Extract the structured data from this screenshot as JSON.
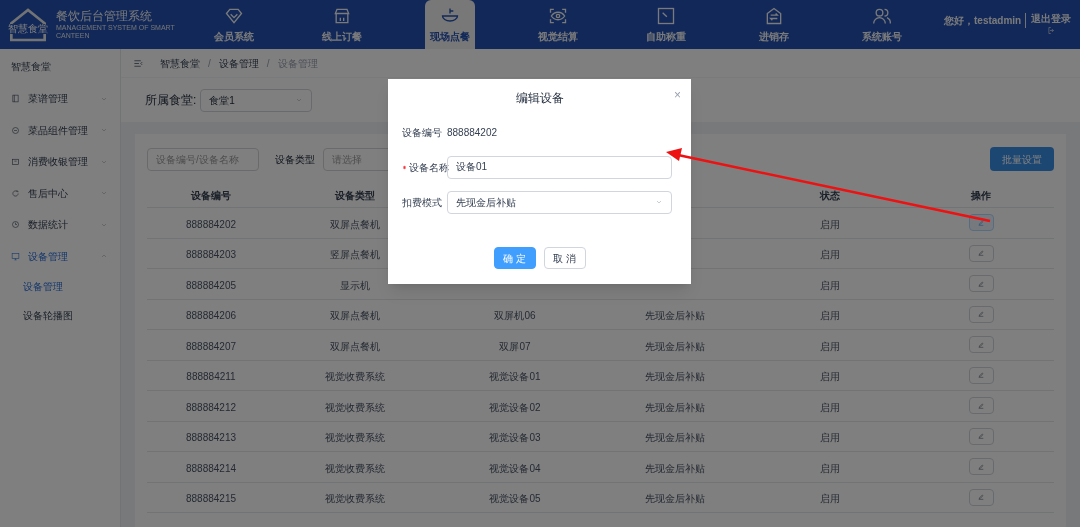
{
  "header": {
    "logo_badge": "智慧食堂",
    "title": "餐饮后台管理系统",
    "subtitle": "MANAGEMENT SYSTEM OF SMART CANTEEN",
    "nav": [
      {
        "label": "会员系统",
        "kind": "diamond",
        "selected": false
      },
      {
        "label": "线上订餐",
        "kind": "shop",
        "selected": false
      },
      {
        "label": "现场点餐",
        "kind": "bowl",
        "selected": true
      },
      {
        "label": "视觉结算",
        "kind": "eye",
        "selected": false
      },
      {
        "label": "自助称重",
        "kind": "scale",
        "selected": false
      },
      {
        "label": "进销存",
        "kind": "swap",
        "selected": false
      },
      {
        "label": "系统账号",
        "kind": "users",
        "selected": false
      }
    ],
    "greeting": "您好，testadmin",
    "logout": "退出登录"
  },
  "sidebar": {
    "title": "智慧食堂",
    "items": [
      {
        "label": "菜谱管理",
        "kind": "book",
        "expanded": false,
        "selected": false
      },
      {
        "label": "菜品组件管理",
        "kind": "disc",
        "expanded": false,
        "selected": false
      },
      {
        "label": "消费收银管理",
        "kind": "box",
        "expanded": false,
        "selected": false
      },
      {
        "label": "售后中心",
        "kind": "refresh",
        "expanded": false,
        "selected": false
      },
      {
        "label": "数据统计",
        "kind": "clock",
        "expanded": false,
        "selected": false
      },
      {
        "label": "设备管理",
        "kind": "monitor",
        "expanded": true,
        "selected": true,
        "children": [
          {
            "label": "设备管理",
            "selected": true
          },
          {
            "label": "设备轮播图",
            "selected": false
          }
        ]
      }
    ]
  },
  "breadcrumb": [
    {
      "label": "智慧食堂",
      "separator": "/"
    },
    {
      "label": "设备管理",
      "separator": "/"
    },
    {
      "label": "设备管理"
    }
  ],
  "canteen_filter": {
    "label": "所属食堂:",
    "value": "食堂1"
  },
  "search": {
    "placeholder": "设备编号/设备名称",
    "type_label": "设备类型",
    "type_placeholder": "请选择"
  },
  "batch_button": "批量设置",
  "table": {
    "columns": [
      "设备编号",
      "设备类型",
      null,
      null,
      "状态",
      "操作"
    ],
    "rows": [
      {
        "number": "888884202",
        "type": "双屏点餐机",
        "status": "启用",
        "selected": true
      },
      {
        "number": "888884203",
        "type": "竖屏点餐机",
        "status": "启用",
        "selected": false
      },
      {
        "number": "888884205",
        "type": "显示机",
        "status": "启用",
        "selected": false
      },
      {
        "number": "888884206",
        "type": "双屏点餐机",
        "name": "双屏机06",
        "mode": "先现金后补贴",
        "status": "启用",
        "selected": false
      },
      {
        "number": "888884207",
        "type": "双屏点餐机",
        "name": "双屏07",
        "mode": "先现金后补贴",
        "status": "启用",
        "selected": false
      },
      {
        "number": "888884211",
        "type": "视觉收费系统",
        "name": "视觉设备01",
        "mode": "先现金后补贴",
        "status": "启用",
        "selected": false
      },
      {
        "number": "888884212",
        "type": "视觉收费系统",
        "name": "视觉设备02",
        "mode": "先现金后补贴",
        "status": "启用",
        "selected": false
      },
      {
        "number": "888884213",
        "type": "视觉收费系统",
        "name": "视觉设备03",
        "mode": "先现金后补贴",
        "status": "启用",
        "selected": false
      },
      {
        "number": "888884214",
        "type": "视觉收费系统",
        "name": "视觉设备04",
        "mode": "先现金后补贴",
        "status": "启用",
        "selected": false
      },
      {
        "number": "888884215",
        "type": "视觉收费系统",
        "name": "视觉设备05",
        "mode": "先现金后补贴",
        "status": "启用",
        "selected": false
      }
    ]
  },
  "dialog": {
    "title": "编辑设备",
    "close": "×",
    "fields": [
      {
        "label": "设备编号",
        "kind": "text",
        "value": "888884202",
        "required": false
      },
      {
        "label": "设备名称",
        "kind": "input",
        "value": "设备01",
        "required": true
      },
      {
        "label": "扣费模式",
        "kind": "select",
        "value": "先现金后补贴",
        "required": false
      }
    ],
    "buttons": [
      {
        "label": "确 定",
        "kind": "primary"
      },
      {
        "label": "取 消",
        "kind": "plain"
      }
    ]
  }
}
